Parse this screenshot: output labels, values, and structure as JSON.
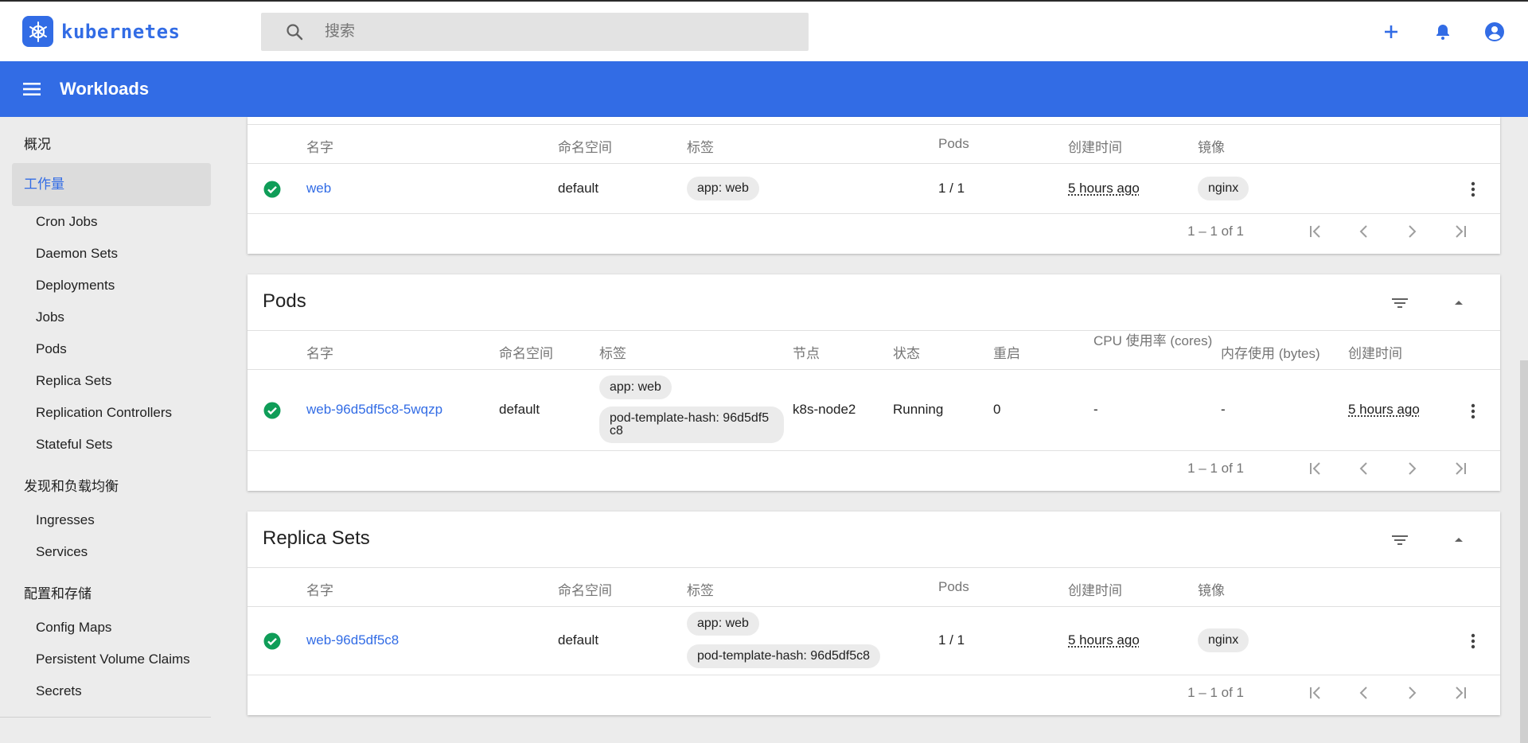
{
  "app": {
    "logo_text": "kubernetes",
    "search_placeholder": "搜索",
    "header_title": "Workloads",
    "brand_color": "#326ce5",
    "icons": [
      "kubernetes-logo",
      "search-icon",
      "plus-icon",
      "bell-icon",
      "account-icon",
      "menu-icon"
    ]
  },
  "sidebar": {
    "overview": "概况",
    "workloads": "工作量",
    "workload_items": [
      "Cron Jobs",
      "Daemon Sets",
      "Deployments",
      "Jobs",
      "Pods",
      "Replica Sets",
      "Replication Controllers",
      "Stateful Sets"
    ],
    "discovery": "发现和负载均衡",
    "discovery_items": [
      "Ingresses",
      "Services"
    ],
    "config": "配置和存储",
    "config_items": [
      "Config Maps",
      "Persistent Volume Claims",
      "Secrets"
    ]
  },
  "deployments": {
    "columns": [
      "名字",
      "命名空间",
      "标签",
      "Pods",
      "创建时间",
      "镜像"
    ],
    "row": {
      "status": "ok",
      "name": "web",
      "namespace": "default",
      "label": "app: web",
      "pods": "1 / 1",
      "created": "5 hours ago",
      "image": "nginx"
    },
    "pager": "1 – 1 of 1"
  },
  "pods": {
    "title": "Pods",
    "columns": {
      "name": "名字",
      "namespace": "命名空间",
      "labels": "标签",
      "node": "节点",
      "status": "状态",
      "restarts": "重启",
      "cpu": "CPU 使用率 (cores)",
      "memory": "内存使用 (bytes)",
      "created": "创建时间"
    },
    "row": {
      "status_icon": "ok",
      "name": "web-96d5df5c8-5wqzp",
      "namespace": "default",
      "label1": "app: web",
      "label2": "pod-template-hash: 96d5df5c8",
      "node": "k8s-node2",
      "status": "Running",
      "restarts": "0",
      "cpu": "-",
      "memory": "-",
      "created": "5 hours ago"
    },
    "pager": "1 – 1 of 1"
  },
  "replicasets": {
    "title": "Replica Sets",
    "columns": [
      "名字",
      "命名空间",
      "标签",
      "Pods",
      "创建时间",
      "镜像"
    ],
    "row": {
      "status": "ok",
      "name": "web-96d5df5c8",
      "namespace": "default",
      "label1": "app: web",
      "label2": "pod-template-hash: 96d5df5c8",
      "pods": "1 / 1",
      "created": "5 hours ago",
      "image": "nginx"
    },
    "pager": "1 – 1 of 1"
  }
}
